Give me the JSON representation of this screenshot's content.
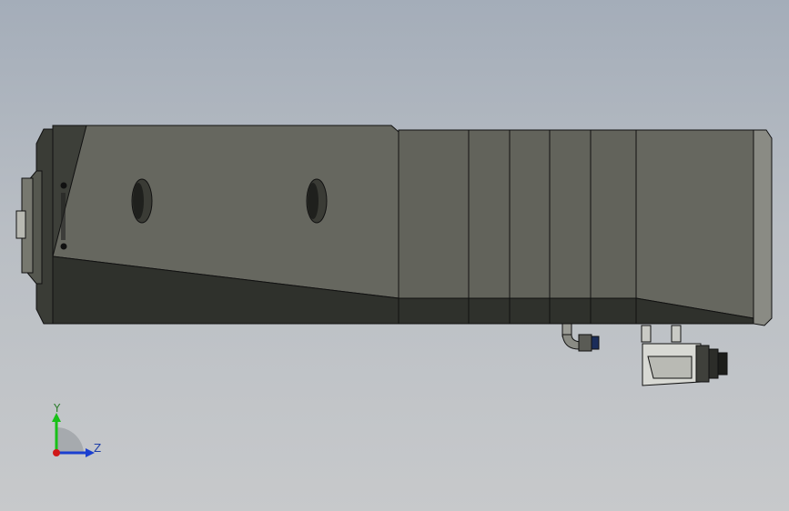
{
  "viewport": {
    "view": "cad-3d-view",
    "background_top": "#a4adb9",
    "background_bottom": "#c7c9cb"
  },
  "model": {
    "body_color": "#4f5149",
    "body_light": "#66675f",
    "body_dark": "#2f312c",
    "edge_color": "#111111"
  },
  "triad": {
    "y_label": "Y",
    "z_label": "Z",
    "y_color": "#18c018",
    "z_color": "#1a3fd0",
    "x_color": "#d01818"
  }
}
